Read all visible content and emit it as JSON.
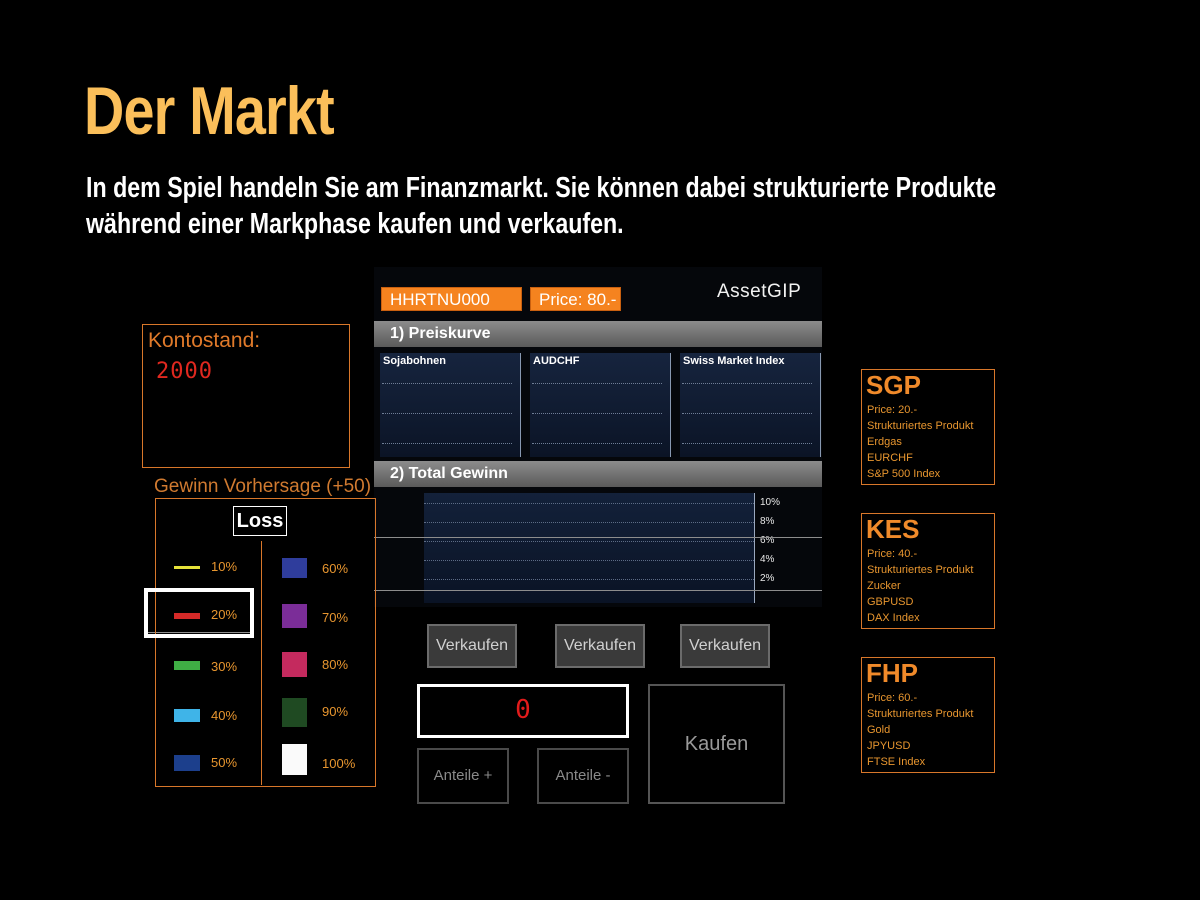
{
  "slide": {
    "title": "Der Markt",
    "subtitle_line1": "In dem Spiel handeln Sie am Finanzmarkt. Sie können dabei strukturierte Produkte",
    "subtitle_line2": "während einer Markphase kaufen und verkaufen."
  },
  "header": {
    "product_id": "HHRTNU000",
    "price": "Price: 80.-",
    "brand": "AssetGIP"
  },
  "section1": {
    "title": "1) Preiskurve",
    "charts": [
      {
        "label": "Sojabohnen"
      },
      {
        "label": "AUDCHF"
      },
      {
        "label": "Swiss Market Index"
      }
    ]
  },
  "section2": {
    "title": "2) Total Gewinn",
    "y_ticks": [
      "10%",
      "8%",
      "6%",
      "4%",
      "2%"
    ]
  },
  "actions": {
    "sell_labels": [
      "Verkaufen",
      "Verkaufen",
      "Verkaufen"
    ],
    "quantity": "0",
    "shares_plus": "Anteile +",
    "shares_minus": "Anteile -",
    "buy": "Kaufen"
  },
  "account": {
    "label": "Kontostand:",
    "value": "2000"
  },
  "forecast": {
    "label": "Gewinn Vorhersage (+50)",
    "mode": "Loss",
    "selected": "20%",
    "left": [
      {
        "pct": "10%",
        "color": "#e6e23a"
      },
      {
        "pct": "20%",
        "color": "#d42a28"
      },
      {
        "pct": "30%",
        "color": "#3fae44"
      },
      {
        "pct": "40%",
        "color": "#3fb4e8"
      },
      {
        "pct": "50%",
        "color": "#1c3f8c"
      }
    ],
    "right": [
      {
        "pct": "60%",
        "color": "#2f3d9c"
      },
      {
        "pct": "70%",
        "color": "#7b2d98"
      },
      {
        "pct": "80%",
        "color": "#c42a5e"
      },
      {
        "pct": "90%",
        "color": "#1f4a22"
      },
      {
        "pct": "100%",
        "color": "#fafafa"
      }
    ]
  },
  "products": [
    {
      "name": "SGP",
      "price": "Price: 20.-",
      "type": "Strukturiertes Produkt",
      "u1": "Erdgas",
      "u2": "EURCHF",
      "u3": "S&P 500 Index"
    },
    {
      "name": "KES",
      "price": "Price: 40.-",
      "type": "Strukturiertes Produkt",
      "u1": "Zucker",
      "u2": "GBPUSD",
      "u3": "DAX Index"
    },
    {
      "name": "FHP",
      "price": "Price: 60.-",
      "type": "Strukturiertes Produkt",
      "u1": "Gold",
      "u2": "JPYUSD",
      "u3": "FTSE Index"
    }
  ]
}
